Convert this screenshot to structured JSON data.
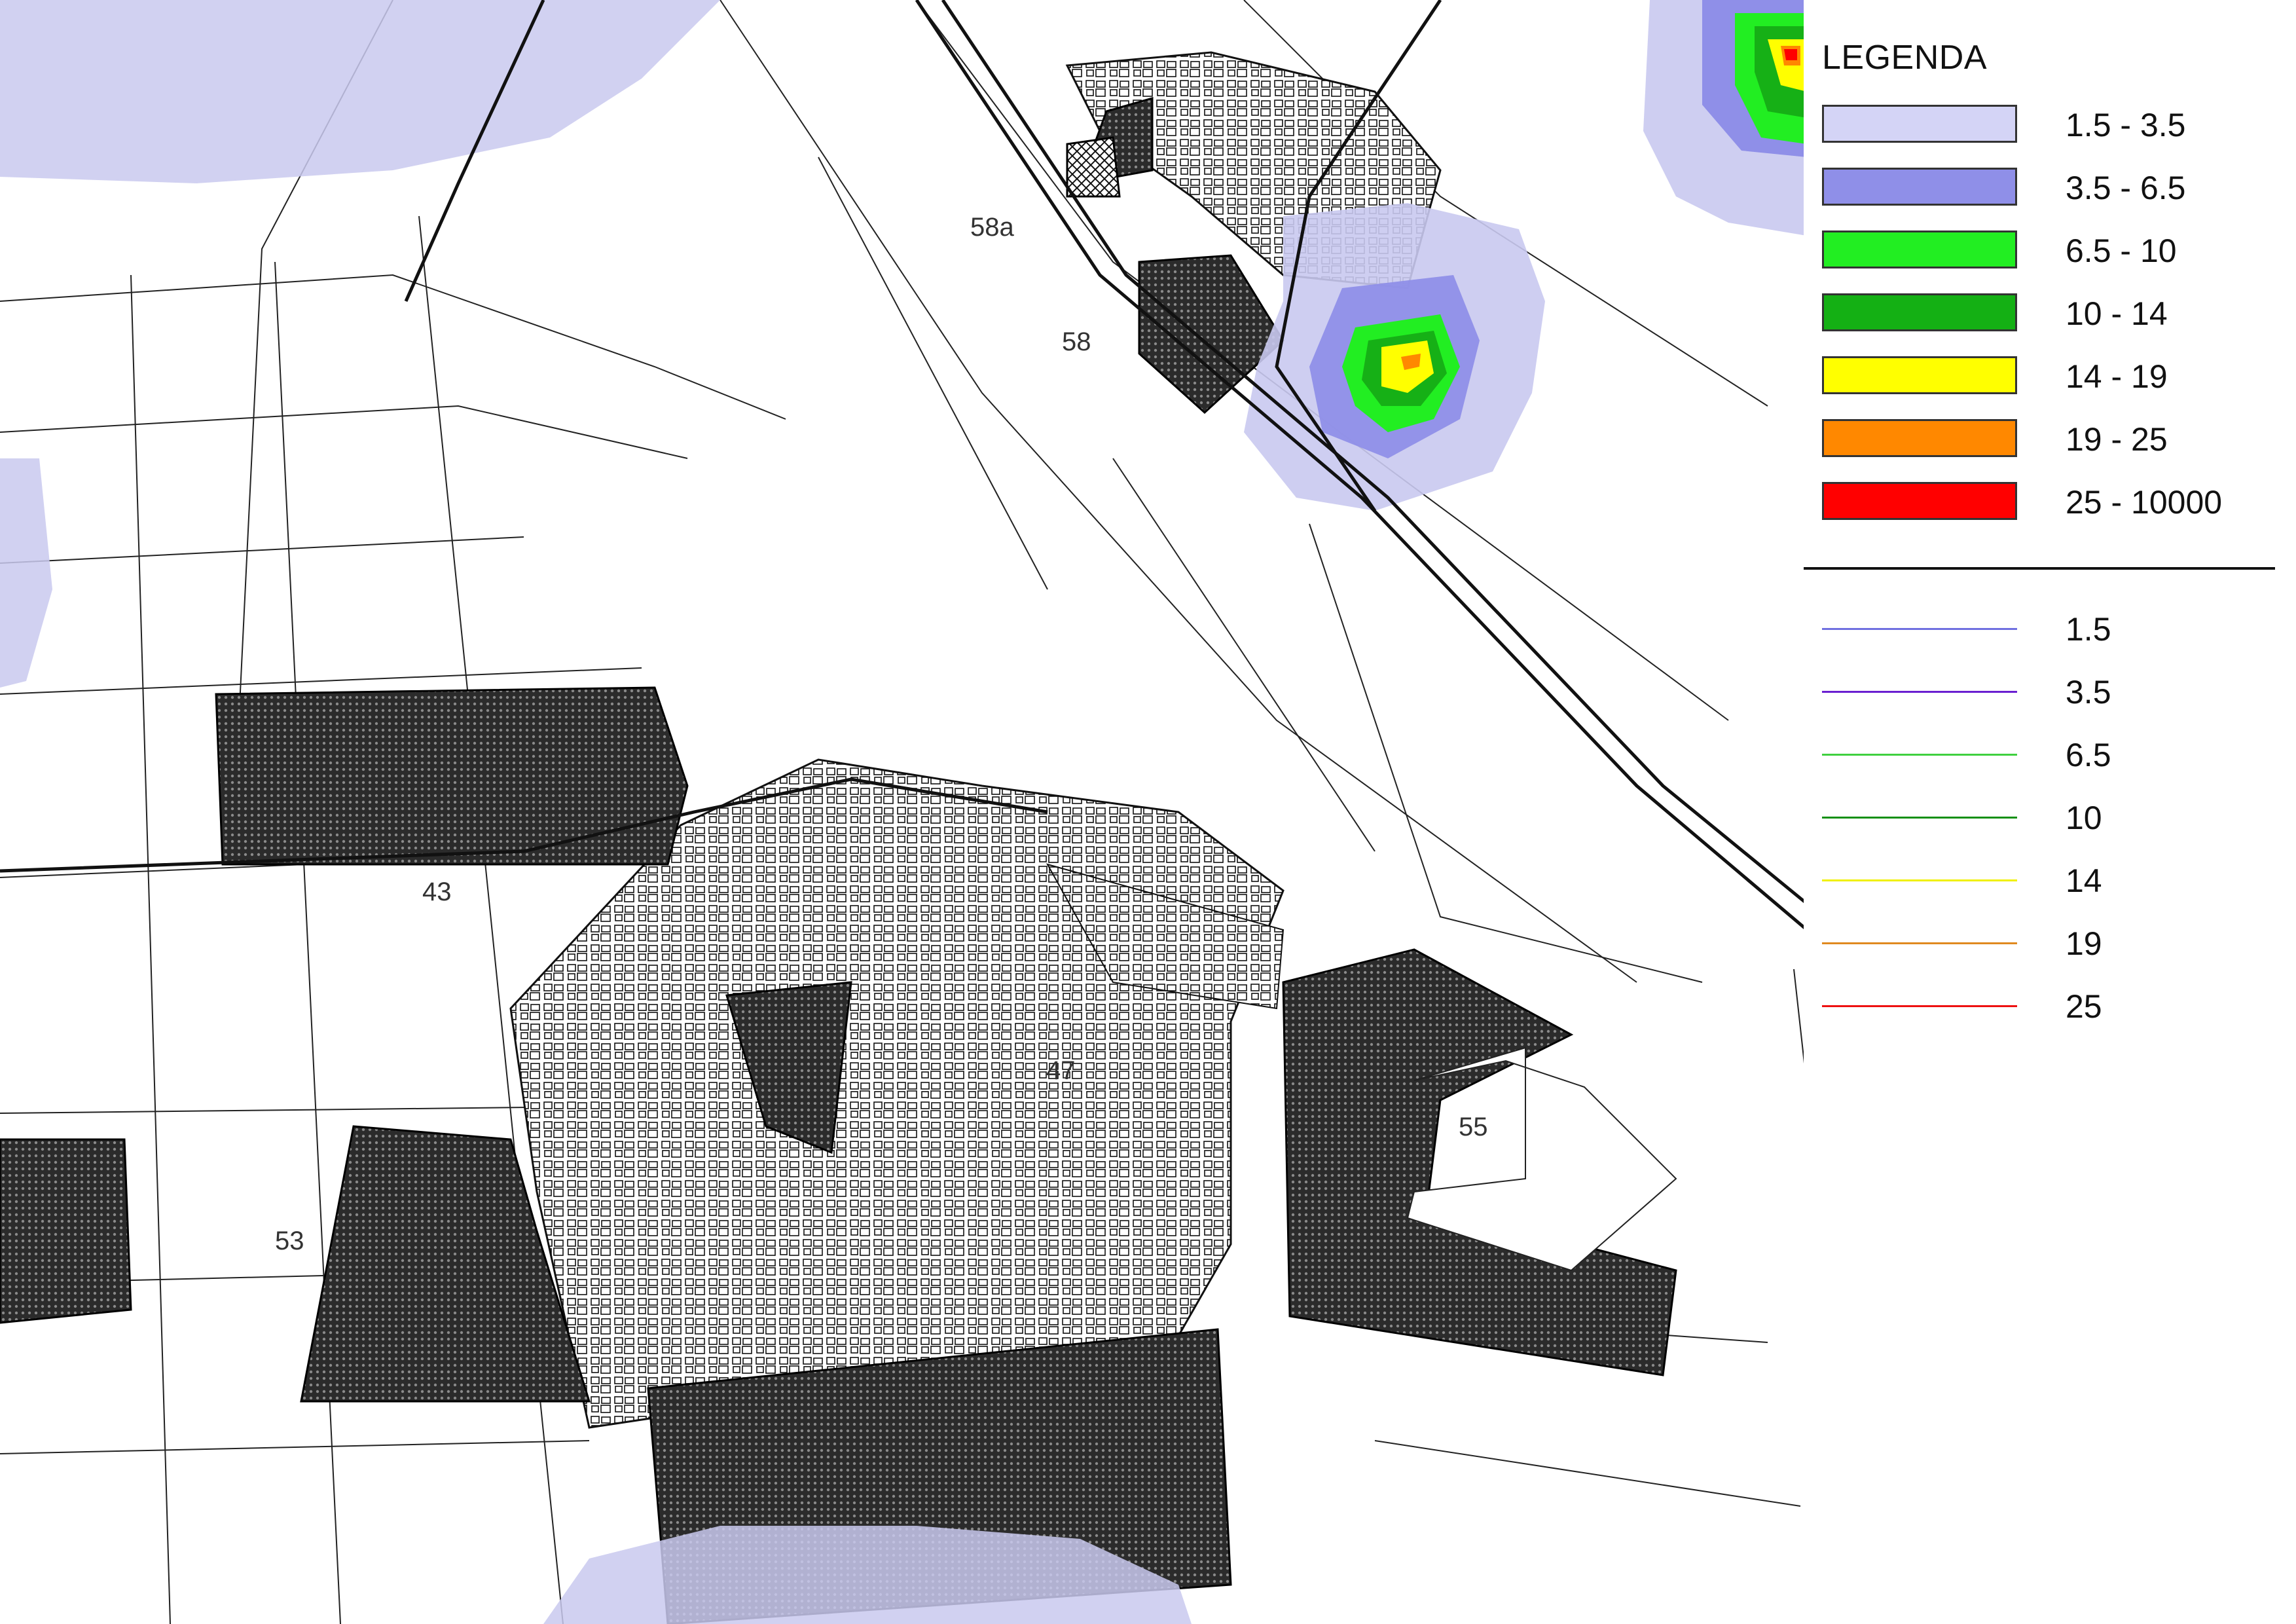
{
  "map": {
    "parcel_labels": [
      "58a",
      "58",
      "43",
      "47",
      "53",
      "55"
    ],
    "contour_colors": {
      "c1_5": "#c9c9ef",
      "c3_5": "#8f8fe8",
      "c6_5": "#22ee22",
      "c10": "#16b016",
      "c14": "#ffff00",
      "c19": "#ff8800",
      "c25": "#ff0000"
    }
  },
  "legend": {
    "title": "LEGENDA",
    "fill_classes": [
      {
        "label": "1.5 - 3.5",
        "color": "#d4d4f6"
      },
      {
        "label": "3.5 - 6.5",
        "color": "#8f8fe8"
      },
      {
        "label": "6.5 - 10",
        "color": "#22ee22"
      },
      {
        "label": "10 - 14",
        "color": "#14b014"
      },
      {
        "label": "14 - 19",
        "color": "#ffff00"
      },
      {
        "label": "19 - 25",
        "color": "#ff8800"
      },
      {
        "label": "25 - 10000",
        "color": "#ff0000"
      }
    ],
    "line_classes": [
      {
        "label": "1.5",
        "color": "#7070e0"
      },
      {
        "label": "3.5",
        "color": "#6a1fd0"
      },
      {
        "label": "6.5",
        "color": "#40d040"
      },
      {
        "label": "10",
        "color": "#149014"
      },
      {
        "label": "14",
        "color": "#f0f000"
      },
      {
        "label": "19",
        "color": "#e08a20"
      },
      {
        "label": "25",
        "color": "#ee1111"
      }
    ]
  }
}
